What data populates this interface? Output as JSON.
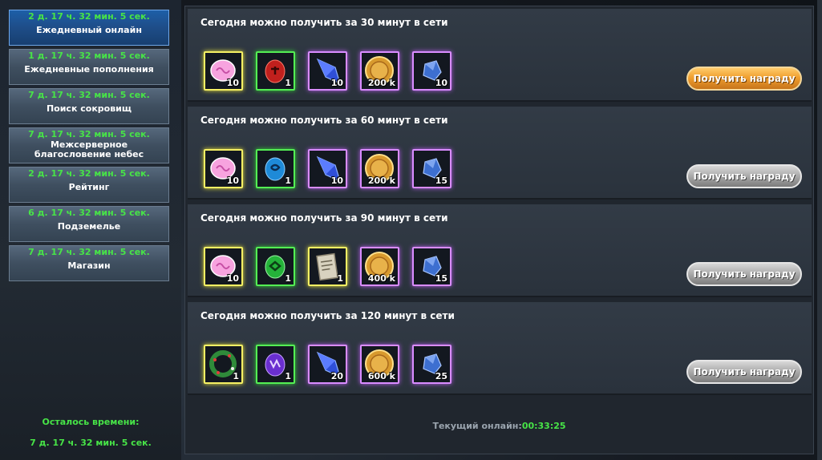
{
  "sidebar": {
    "items": [
      {
        "timer": "2 д. 17 ч. 32 мин. 5 сек.",
        "label": "Ежедневный онлайн"
      },
      {
        "timer": "1 д. 17 ч. 32 мин. 5 сек.",
        "label": "Ежедневные пополнения"
      },
      {
        "timer": "7 д. 17 ч. 32 мин. 5 сек.",
        "label": "Поиск сокровищ"
      },
      {
        "timer": "7 д. 17 ч. 32 мин. 5 сек.",
        "label_line1": "Межсерверное",
        "label_line2": "благословение небес"
      },
      {
        "timer": "2 д. 17 ч. 32 мин. 5 сек.",
        "label": "Рейтинг"
      },
      {
        "timer": "6 д. 17 ч. 32 мин. 5 сек.",
        "label": "Подземелье"
      },
      {
        "timer": "7 д. 17 ч. 32 мин. 5 сек.",
        "label": "Магазин"
      }
    ],
    "remaining_label": "Осталось времени:",
    "remaining_value": "7 д. 17 ч. 32 мин. 5 сек."
  },
  "rewards": [
    {
      "title": "Сегодня можно получить за 30 минут в сети",
      "button": "Получить награду",
      "button_active": true,
      "items": [
        {
          "icon": "pink-gem-icon",
          "qty": "10"
        },
        {
          "icon": "red-rune-stone-icon",
          "qty": "1"
        },
        {
          "icon": "blue-crystal-icon",
          "qty": "10"
        },
        {
          "icon": "gold-coin-icon",
          "qty": "200 k"
        },
        {
          "icon": "blue-ore-icon",
          "qty": "10"
        }
      ]
    },
    {
      "title": "Сегодня можно получить за 60 минут в сети",
      "button": "Получить награду",
      "button_active": false,
      "items": [
        {
          "icon": "pink-gem-icon",
          "qty": "10"
        },
        {
          "icon": "blue-rune-stone-icon",
          "qty": "1"
        },
        {
          "icon": "blue-crystal-icon",
          "qty": "10"
        },
        {
          "icon": "gold-coin-icon",
          "qty": "200 k"
        },
        {
          "icon": "blue-ore-icon",
          "qty": "15"
        }
      ]
    },
    {
      "title": "Сегодня можно получить за 90 минут в сети",
      "button": "Получить награду",
      "button_active": false,
      "items": [
        {
          "icon": "pink-gem-icon",
          "qty": "10"
        },
        {
          "icon": "green-rune-stone-icon",
          "qty": "1"
        },
        {
          "icon": "scroll-icon",
          "qty": "1"
        },
        {
          "icon": "gold-coin-icon",
          "qty": "400 k"
        },
        {
          "icon": "blue-ore-icon",
          "qty": "15"
        }
      ]
    },
    {
      "title": "Сегодня можно получить за 120 минут в сети",
      "button": "Получить награду",
      "button_active": false,
      "items": [
        {
          "icon": "wreath-icon",
          "qty": "1"
        },
        {
          "icon": "purple-rune-stone-icon",
          "qty": "1"
        },
        {
          "icon": "blue-crystal-icon",
          "qty": "20"
        },
        {
          "icon": "gold-coin-icon",
          "qty": "600 k"
        },
        {
          "icon": "blue-ore-icon",
          "qty": "25"
        }
      ]
    }
  ],
  "footer": {
    "label": "Текущий онлайн:",
    "value": "00:33:25"
  }
}
